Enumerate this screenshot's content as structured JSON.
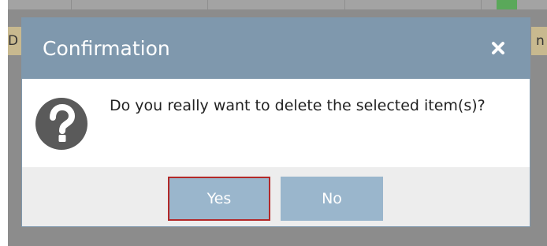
{
  "dialog": {
    "title": "Confirmation",
    "close_icon": "close-icon",
    "message": "Do you really want to delete the selected item(s)?",
    "icon": "question-icon",
    "buttons": {
      "yes_label": "Yes",
      "no_label": "No"
    }
  },
  "background": {
    "left_fragment": "D",
    "right_fragment": "n"
  },
  "colors": {
    "header": "#7f98ad",
    "button": "#9ab6cc",
    "focus_border": "#b32929",
    "footer": "#ededed"
  }
}
